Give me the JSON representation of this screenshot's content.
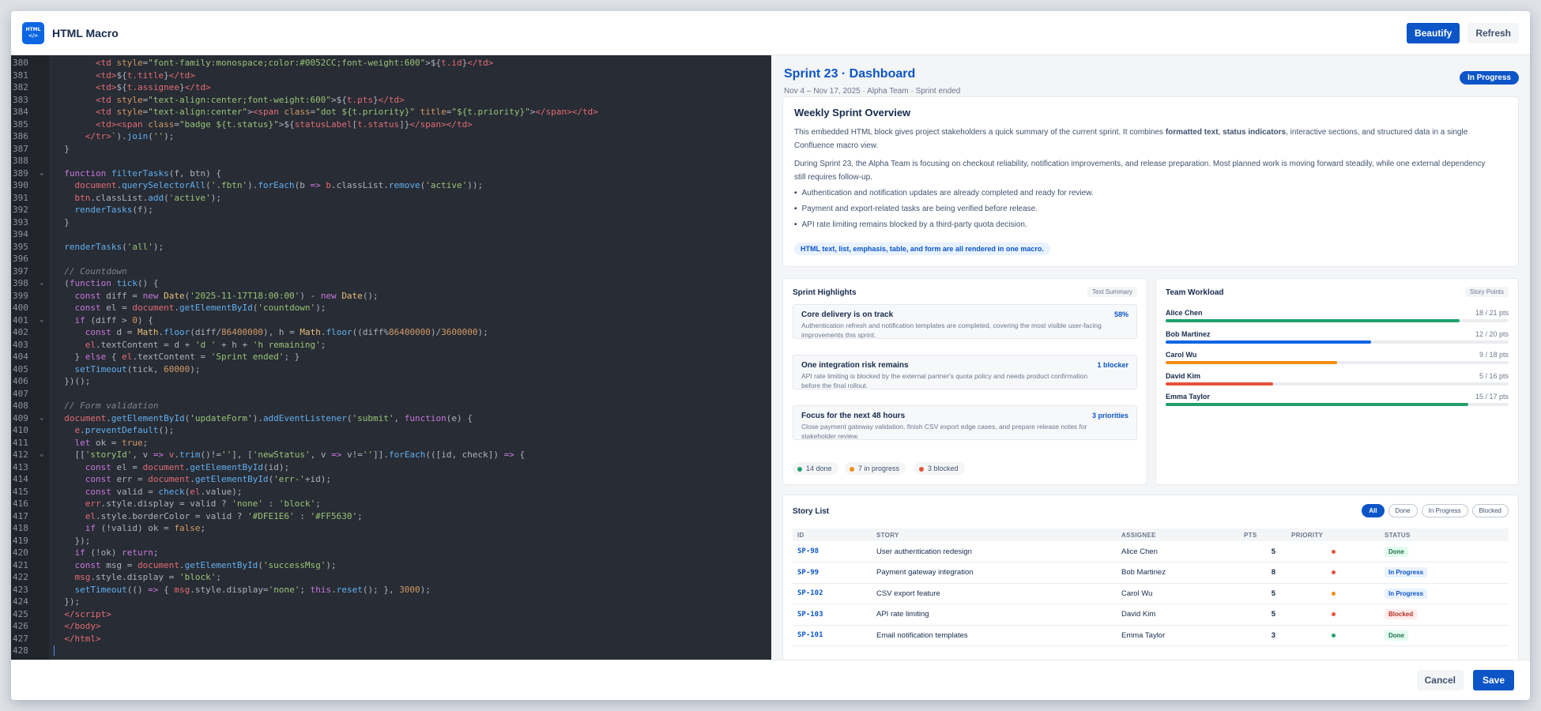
{
  "header": {
    "logo_text": "HTML\n</>",
    "title": "HTML Macro",
    "beautify_label": "Beautify",
    "refresh_label": "Refresh"
  },
  "editor": {
    "lines": [
      {
        "n": "380",
        "f": "",
        "h": "        <span class=\"tg\">&lt;td</span> <span class=\"at\">style</span>=<span class=\"st\">\"font-family:monospace;color:#0052CC;font-weight:600\"</span>&gt;${<span class=\"vr\">t.id</span>}<span class=\"tg\">&lt;/td&gt;</span>"
      },
      {
        "n": "381",
        "f": "",
        "h": "        <span class=\"tg\">&lt;td&gt;</span>${<span class=\"vr\">t.title</span>}<span class=\"tg\">&lt;/td&gt;</span>"
      },
      {
        "n": "382",
        "f": "",
        "h": "        <span class=\"tg\">&lt;td&gt;</span>${<span class=\"vr\">t.assignee</span>}<span class=\"tg\">&lt;/td&gt;</span>"
      },
      {
        "n": "383",
        "f": "",
        "h": "        <span class=\"tg\">&lt;td</span> <span class=\"at\">style</span>=<span class=\"st\">\"text-align:center;font-weight:600\"</span>&gt;${<span class=\"vr\">t.pts</span>}<span class=\"tg\">&lt;/td&gt;</span>"
      },
      {
        "n": "384",
        "f": "",
        "h": "        <span class=\"tg\">&lt;td</span> <span class=\"at\">style</span>=<span class=\"st\">\"text-align:center\"</span>&gt;<span class=\"tg\">&lt;span</span> <span class=\"at\">class</span>=<span class=\"st\">\"dot ${t.priority}\"</span> <span class=\"at\">title</span>=<span class=\"st\">\"${t.priority}\"</span>&gt;<span class=\"tg\">&lt;/span&gt;&lt;/td&gt;</span>"
      },
      {
        "n": "385",
        "f": "",
        "h": "        <span class=\"tg\">&lt;td&gt;&lt;span</span> <span class=\"at\">class</span>=<span class=\"st\">\"badge ${t.status}\"</span>&gt;${<span class=\"vr\">statusLabel</span>[<span class=\"vr\">t.status</span>]}<span class=\"tg\">&lt;/span&gt;&lt;/td&gt;</span>"
      },
      {
        "n": "386",
        "f": "",
        "h": "      <span class=\"tg\">&lt;/tr&gt;</span><span class=\"st\">`</span>).<span class=\"fn\">join</span>(<span class=\"st\">''</span>);"
      },
      {
        "n": "387",
        "f": "",
        "h": "  }"
      },
      {
        "n": "388",
        "f": "",
        "h": ""
      },
      {
        "n": "389",
        "f": "⌄",
        "h": "  <span class=\"kw\">function</span> <span class=\"fn\">filterTasks</span>(f, btn) {"
      },
      {
        "n": "390",
        "f": "",
        "h": "    <span class=\"vr\">document</span>.<span class=\"fn\">querySelectorAll</span>(<span class=\"st\">'.fbtn'</span>).<span class=\"fn\">forEach</span>(b <span class=\"kw\">=&gt;</span> <span class=\"vr\">b</span>.classList.<span class=\"fn\">remove</span>(<span class=\"st\">'active'</span>));"
      },
      {
        "n": "391",
        "f": "",
        "h": "    <span class=\"vr\">btn</span>.classList.<span class=\"fn\">add</span>(<span class=\"st\">'active'</span>);"
      },
      {
        "n": "392",
        "f": "",
        "h": "    <span class=\"fn\">renderTasks</span>(f);"
      },
      {
        "n": "393",
        "f": "",
        "h": "  }"
      },
      {
        "n": "394",
        "f": "",
        "h": ""
      },
      {
        "n": "395",
        "f": "",
        "h": "  <span class=\"fn\">renderTasks</span>(<span class=\"st\">'all'</span>);"
      },
      {
        "n": "396",
        "f": "",
        "h": ""
      },
      {
        "n": "397",
        "f": "",
        "h": "  <span class=\"cm\">// Countdown</span>"
      },
      {
        "n": "398",
        "f": "⌄",
        "h": "  (<span class=\"kw\">function</span> <span class=\"fn\">tick</span>() {"
      },
      {
        "n": "399",
        "f": "",
        "h": "    <span class=\"kw\">const</span> diff = <span class=\"kw\">new</span> <span class=\"ty\">Date</span>(<span class=\"st\">'2025-11-17T18:00:00'</span>) - <span class=\"kw\">new</span> <span class=\"ty\">Date</span>();"
      },
      {
        "n": "400",
        "f": "",
        "h": "    <span class=\"kw\">const</span> el = <span class=\"vr\">document</span>.<span class=\"fn\">getElementById</span>(<span class=\"st\">'countdown'</span>);"
      },
      {
        "n": "401",
        "f": "⌄",
        "h": "    <span class=\"kw\">if</span> (diff &gt; <span class=\"nm\">0</span>) {"
      },
      {
        "n": "402",
        "f": "",
        "h": "      <span class=\"kw\">const</span> d = <span class=\"ty\">Math</span>.<span class=\"fn\">floor</span>(diff/<span class=\"nm\">86400000</span>), h = <span class=\"ty\">Math</span>.<span class=\"fn\">floor</span>((diff%<span class=\"nm\">86400000</span>)/<span class=\"nm\">3600000</span>);"
      },
      {
        "n": "403",
        "f": "",
        "h": "      <span class=\"vr\">el</span>.textContent = d + <span class=\"st\">'d '</span> + h + <span class=\"st\">'h remaining'</span>;"
      },
      {
        "n": "404",
        "f": "",
        "h": "    } <span class=\"kw\">else</span> { <span class=\"vr\">el</span>.textContent = <span class=\"st\">'Sprint ended'</span>; }"
      },
      {
        "n": "405",
        "f": "",
        "h": "    <span class=\"fn\">setTimeout</span>(tick, <span class=\"nm\">60000</span>);"
      },
      {
        "n": "406",
        "f": "",
        "h": "  })();"
      },
      {
        "n": "407",
        "f": "",
        "h": ""
      },
      {
        "n": "408",
        "f": "",
        "h": "  <span class=\"cm\">// Form validation</span>"
      },
      {
        "n": "409",
        "f": "⌄",
        "h": "  <span class=\"vr\">document</span>.<span class=\"fn\">getElementById</span>(<span class=\"st\">'updateForm'</span>).<span class=\"fn\">addEventListener</span>(<span class=\"st\">'submit'</span>, <span class=\"kw\">function</span>(e) {"
      },
      {
        "n": "410",
        "f": "",
        "h": "    <span class=\"vr\">e</span>.<span class=\"fn\">preventDefault</span>();"
      },
      {
        "n": "411",
        "f": "",
        "h": "    <span class=\"kw\">let</span> ok = <span class=\"nm\">true</span>;"
      },
      {
        "n": "412",
        "f": "⌄",
        "h": "    [[<span class=\"st\">'storyId'</span>, v <span class=\"kw\">=&gt;</span> <span class=\"vr\">v</span>.<span class=\"fn\">trim</span>()!=<span class=\"st\">''</span>], [<span class=\"st\">'newStatus'</span>, v <span class=\"kw\">=&gt;</span> v!=<span class=\"st\">''</span>]].<span class=\"fn\">forEach</span>(([id, check]) <span class=\"kw\">=&gt;</span> {"
      },
      {
        "n": "413",
        "f": "",
        "h": "      <span class=\"kw\">const</span> el = <span class=\"vr\">document</span>.<span class=\"fn\">getElementById</span>(id);"
      },
      {
        "n": "414",
        "f": "",
        "h": "      <span class=\"kw\">const</span> err = <span class=\"vr\">document</span>.<span class=\"fn\">getElementById</span>(<span class=\"st\">'err-'</span>+id);"
      },
      {
        "n": "415",
        "f": "",
        "h": "      <span class=\"kw\">const</span> valid = <span class=\"fn\">check</span>(<span class=\"vr\">el</span>.value);"
      },
      {
        "n": "416",
        "f": "",
        "h": "      <span class=\"vr\">err</span>.style.display = valid ? <span class=\"st\">'none'</span> : <span class=\"st\">'block'</span>;"
      },
      {
        "n": "417",
        "f": "",
        "h": "      <span class=\"vr\">el</span>.style.borderColor = valid ? <span class=\"st\">'#DFE1E6'</span> : <span class=\"st\">'#FF5630'</span>;"
      },
      {
        "n": "418",
        "f": "",
        "h": "      <span class=\"kw\">if</span> (!valid) ok = <span class=\"nm\">false</span>;"
      },
      {
        "n": "419",
        "f": "",
        "h": "    });"
      },
      {
        "n": "420",
        "f": "",
        "h": "    <span class=\"kw\">if</span> (!ok) <span class=\"kw\">return</span>;"
      },
      {
        "n": "421",
        "f": "",
        "h": "    <span class=\"kw\">const</span> msg = <span class=\"vr\">document</span>.<span class=\"fn\">getElementById</span>(<span class=\"st\">'successMsg'</span>);"
      },
      {
        "n": "422",
        "f": "",
        "h": "    <span class=\"vr\">msg</span>.style.display = <span class=\"st\">'block'</span>;"
      },
      {
        "n": "423",
        "f": "",
        "h": "    <span class=\"fn\">setTimeout</span>(() <span class=\"kw\">=&gt;</span> { <span class=\"vr\">msg</span>.style.display=<span class=\"st\">'none'</span>; <span class=\"kw\">this</span>.<span class=\"fn\">reset</span>(); }, <span class=\"nm\">3000</span>);"
      },
      {
        "n": "424",
        "f": "",
        "h": "  });"
      },
      {
        "n": "425",
        "f": "",
        "h": "  <span class=\"tg\">&lt;/script&gt;</span>"
      },
      {
        "n": "426",
        "f": "",
        "h": "  <span class=\"tg\">&lt;/body&gt;</span>"
      },
      {
        "n": "427",
        "f": "",
        "h": "  <span class=\"tg\">&lt;/html&gt;</span>"
      },
      {
        "n": "428",
        "f": "",
        "h": ""
      }
    ]
  },
  "preview": {
    "title": "Sprint 23 · Dashboard",
    "subtitle": "Nov 4 – Nov 17, 2025  ·  Alpha Team  ·  Sprint ended",
    "status": "In Progress",
    "overview": {
      "title": "Weekly Sprint Overview",
      "p1_a": "This embedded HTML block gives project stakeholders a quick summary of the current sprint. It combines ",
      "p1_b1": "formatted text",
      "p1_c": ", ",
      "p1_b2": "status indicators",
      "p1_d": ", interactive sections, and structured data in a single Confluence macro view.",
      "p2": "During Sprint 23, the Alpha Team is focusing on checkout reliability, notification improvements, and release preparation. Most planned work is moving forward steadily, while one external dependency still requires follow-up.",
      "bullets": [
        "Authentication and notification updates are already completed and ready for review.",
        "Payment and export-related tasks are being verified before release.",
        "API rate limiting remains blocked by a third-party quota decision."
      ],
      "tag": "HTML text, list, emphasis, table, and form are all rendered in one macro."
    },
    "highlights": {
      "title": "Sprint Highlights",
      "badge": "Text Summary",
      "items": [
        {
          "title": "Core delivery is on track",
          "value": "58%",
          "desc": "Authentication refresh and notification templates are completed, covering the most visible user-facing improvements this sprint."
        },
        {
          "title": "One integration risk remains",
          "value": "1 blocker",
          "desc": "API rate limiting is blocked by the external partner's quota policy and needs product confirmation before the final rollout."
        },
        {
          "title": "Focus for the next 48 hours",
          "value": "3 priorities",
          "desc": "Close payment gateway validation, finish CSV export edge cases, and prepare release notes for stakeholder review."
        }
      ],
      "chips": [
        {
          "label": "14 done",
          "color": "#22a06b"
        },
        {
          "label": "7 in progress",
          "color": "#f18d13"
        },
        {
          "label": "3 blocked",
          "color": "#e5533b"
        }
      ]
    },
    "workload": {
      "title": "Team Workload",
      "badge": "Story Points",
      "members": [
        {
          "name": "Alice Chen",
          "pts": "18 / 21 pts",
          "fraction": 0.857,
          "color": "#22a06b"
        },
        {
          "name": "Bob Martinez",
          "pts": "12 / 20 pts",
          "fraction": 0.6,
          "color": "#0c66e4"
        },
        {
          "name": "Carol Wu",
          "pts": "9 / 18 pts",
          "fraction": 0.5,
          "color": "#f18d13"
        },
        {
          "name": "David Kim",
          "pts": "5 / 16 pts",
          "fraction": 0.3125,
          "color": "#e5533b"
        },
        {
          "name": "Emma Taylor",
          "pts": "15 / 17 pts",
          "fraction": 0.882,
          "color": "#22a06b"
        }
      ]
    },
    "stories": {
      "title": "Story List",
      "filters": [
        "All",
        "Done",
        "In Progress",
        "Blocked"
      ],
      "active_filter": "All",
      "columns": [
        "ID",
        "STORY",
        "ASSIGNEE",
        "PTS",
        "PRIORITY",
        "STATUS"
      ],
      "rows": [
        {
          "id": "SP-98",
          "story": "User authentication redesign",
          "assignee": "Alice Chen",
          "pts": "5",
          "priority_color": "#e5533b",
          "status": "Done",
          "status_class": "b-done"
        },
        {
          "id": "SP-99",
          "story": "Payment gateway integration",
          "assignee": "Bob Martinez",
          "pts": "8",
          "priority_color": "#e5533b",
          "status": "In Progress",
          "status_class": "b-prog"
        },
        {
          "id": "SP-102",
          "story": "CSV export feature",
          "assignee": "Carol Wu",
          "pts": "5",
          "priority_color": "#f18d13",
          "status": "In Progress",
          "status_class": "b-prog"
        },
        {
          "id": "SP-103",
          "story": "API rate limiting",
          "assignee": "David Kim",
          "pts": "5",
          "priority_color": "#e5533b",
          "status": "Blocked",
          "status_class": "b-blk"
        },
        {
          "id": "SP-101",
          "story": "Email notification templates",
          "assignee": "Emma Taylor",
          "pts": "3",
          "priority_color": "#22a06b",
          "status": "Done",
          "status_class": "b-done"
        }
      ]
    }
  },
  "footer": {
    "cancel_label": "Cancel",
    "save_label": "Save"
  }
}
